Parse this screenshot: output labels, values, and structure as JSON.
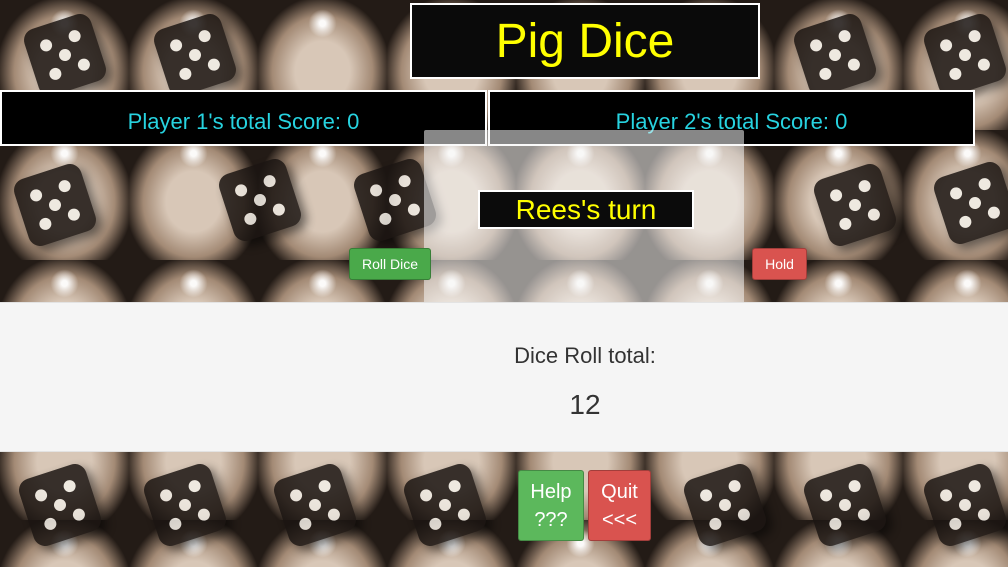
{
  "app": {
    "title": "Pig Dice"
  },
  "scores": {
    "player1": "Player 1's total Score: 0",
    "player2": "Player 2's total Score: 0"
  },
  "turn": {
    "label": "Rees's turn"
  },
  "controls": {
    "roll_label": "Roll Dice",
    "hold_label": "Hold"
  },
  "dice_roll": {
    "label": "Dice Roll total:",
    "value": "12"
  },
  "footer": {
    "help_line1": "Help",
    "help_line2": "???",
    "quit_line1": "Quit",
    "quit_line2": "<<<"
  },
  "colors": {
    "title_text": "#ffff00",
    "score_text": "#27d3e0",
    "roll_button": "#4aa94a",
    "hold_button": "#d9534f",
    "help_button": "#5cb85c",
    "quit_button": "#d9534f"
  }
}
